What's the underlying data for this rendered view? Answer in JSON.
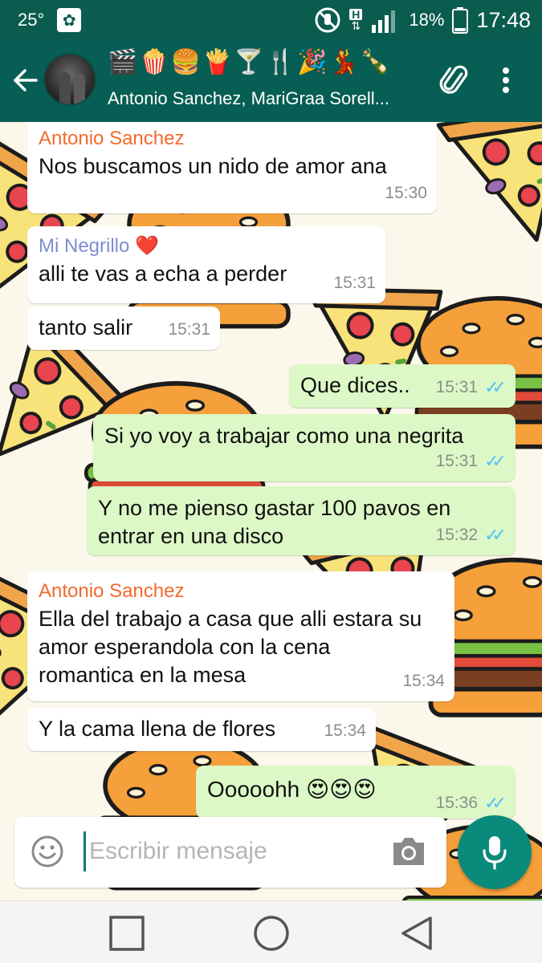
{
  "status_bar": {
    "temperature": "25°",
    "network_type": "H",
    "battery": "18%",
    "time": "17:48"
  },
  "header": {
    "group_emojis": "🎬🍿🍔🍟🍸🍴🎉💃🍾",
    "members": "Antonio Sanchez, MariGraa Sorell...",
    "icons": [
      "back-arrow-icon",
      "paperclip-icon",
      "more-vert-icon"
    ]
  },
  "messages": [
    {
      "direction": "in",
      "sender": "Antonio Sanchez",
      "sender_color": "#f26a2e",
      "text": "Nos buscamos un nido de amor ana",
      "time": "15:30"
    },
    {
      "direction": "in",
      "sender": "Mi Negrillo ❤️",
      "sender_color": "#7d8ecf",
      "text": "alli te vas a echa a perder",
      "time": "15:31"
    },
    {
      "direction": "in",
      "text": "tanto salir",
      "time": "15:31"
    },
    {
      "direction": "out",
      "text": "Que dices..",
      "time": "15:31",
      "status": "read"
    },
    {
      "direction": "out",
      "text": "Si yo voy a trabajar como una negrita",
      "time": "15:31",
      "status": "read"
    },
    {
      "direction": "out",
      "text": "Y no me pienso gastar 100 pavos en entrar en una disco",
      "time": "15:32",
      "status": "read"
    },
    {
      "direction": "in",
      "sender": "Antonio Sanchez",
      "sender_color": "#f26a2e",
      "text": "Ella del trabajo a casa que alli estara su amor esperandola con la cena romantica en la mesa",
      "time": "15:34"
    },
    {
      "direction": "in",
      "text": "Y la cama llena de flores",
      "time": "15:34"
    },
    {
      "direction": "out",
      "text": "Ooooohh 😍😍😍",
      "time": "15:36",
      "status": "read"
    }
  ],
  "tick_glyph": "✓✓",
  "input": {
    "placeholder": "Escribir mensaje"
  },
  "colors": {
    "toolbar": "#075e54",
    "status_bar": "#0a5c4f",
    "outgoing_bubble": "#dcf8c6",
    "incoming_bubble": "#ffffff",
    "read_ticks": "#4fc3f7",
    "mic_button": "#0a8a7a"
  }
}
